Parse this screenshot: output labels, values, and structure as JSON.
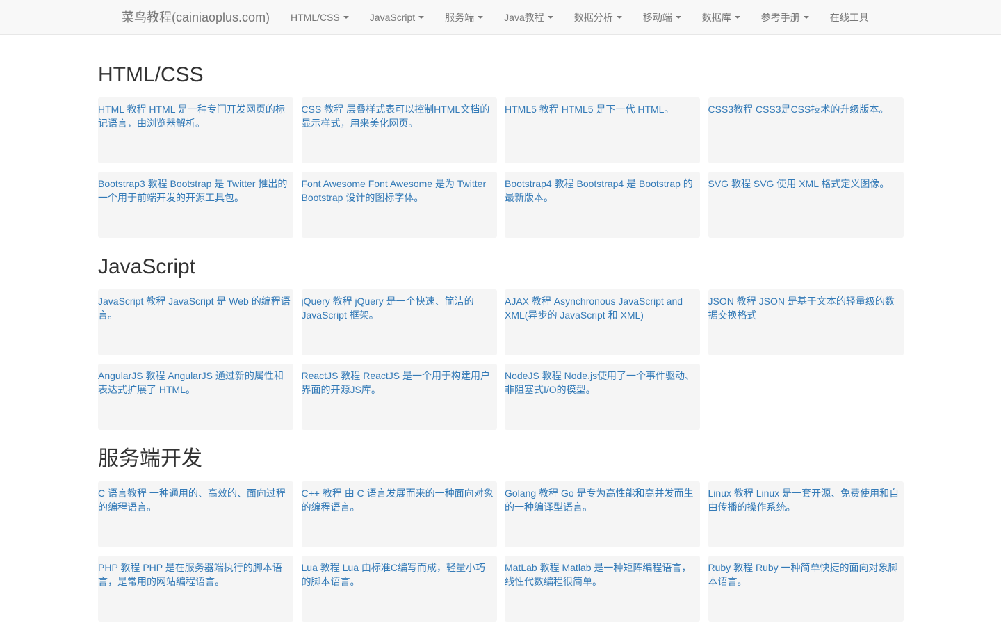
{
  "brand": "菜鸟教程(cainiaoplus.com)",
  "nav": [
    {
      "label": "HTML/CSS",
      "dropdown": true
    },
    {
      "label": "JavaScript",
      "dropdown": true
    },
    {
      "label": "服务端",
      "dropdown": true
    },
    {
      "label": "Java教程",
      "dropdown": true
    },
    {
      "label": "数据分析",
      "dropdown": true
    },
    {
      "label": "移动端",
      "dropdown": true
    },
    {
      "label": "数据库",
      "dropdown": true
    },
    {
      "label": "参考手册",
      "dropdown": true
    },
    {
      "label": "在线工具",
      "dropdown": false
    }
  ],
  "sections": [
    {
      "title": "HTML/CSS",
      "cards": [
        {
          "name": "HTML 教程",
          "desc": "HTML 是一种专门开发网页的标记语言，由浏览器解析。"
        },
        {
          "name": "CSS 教程",
          "desc": "层叠样式表可以控制HTML文档的显示样式，用来美化网页。"
        },
        {
          "name": "HTML5 教程",
          "desc": "HTML5 是下一代 HTML。"
        },
        {
          "name": "CSS3教程",
          "desc": "CSS3是CSS技术的升级版本。"
        },
        {
          "name": "Bootstrap3 教程",
          "desc": "Bootstrap 是 Twitter 推出的一个用于前端开发的开源工具包。"
        },
        {
          "name": "Font Awesome",
          "desc": "Font Awesome 是为 Twitter Bootstrap 设计的图标字体。"
        },
        {
          "name": "Bootstrap4 教程",
          "desc": "Bootstrap4 是 Bootstrap 的最新版本。"
        },
        {
          "name": "SVG 教程",
          "desc": "SVG 使用 XML 格式定义图像。"
        }
      ]
    },
    {
      "title": "JavaScript",
      "cards": [
        {
          "name": "JavaScript 教程",
          "desc": "JavaScript 是 Web 的编程语言。"
        },
        {
          "name": "jQuery 教程",
          "desc": "jQuery 是一个快速、简洁的JavaScript 框架。"
        },
        {
          "name": "AJAX 教程",
          "desc": "Asynchronous JavaScript and XML(异步的 JavaScript 和 XML)"
        },
        {
          "name": "JSON 教程",
          "desc": "JSON 是基于文本的轻量级的数据交换格式"
        },
        {
          "name": "AngularJS 教程",
          "desc": "AngularJS 通过新的属性和表达式扩展了 HTML。"
        },
        {
          "name": "ReactJS 教程",
          "desc": "ReactJS 是一个用于构建用户界面的开源JS库。"
        },
        {
          "name": "NodeJS 教程",
          "desc": "Node.js使用了一个事件驱动、非阻塞式I/O的模型。"
        }
      ]
    },
    {
      "title": "服务端开发",
      "cards": [
        {
          "name": "C 语言教程",
          "desc": "一种通用的、高效的、面向过程的编程语言。"
        },
        {
          "name": "C++ 教程",
          "desc": "由 C 语言发展而来的一种面向对象的编程语言。"
        },
        {
          "name": "Golang 教程",
          "desc": "Go 是专为高性能和高并发而生的一种编译型语言。"
        },
        {
          "name": "Linux 教程",
          "desc": "Linux 是一套开源、免费使用和自由传播的操作系统。"
        },
        {
          "name": "PHP 教程",
          "desc": "PHP 是在服务器端执行的脚本语言，是常用的网站编程语言。"
        },
        {
          "name": "Lua 教程",
          "desc": "Lua 由标准C编写而成，轻量小巧的脚本语言。"
        },
        {
          "name": "MatLab 教程",
          "desc": "Matlab 是一种矩阵编程语言，线性代数编程很简单。"
        },
        {
          "name": "Ruby 教程",
          "desc": "Ruby 一种简单快捷的面向对象脚本语言。"
        }
      ]
    }
  ]
}
